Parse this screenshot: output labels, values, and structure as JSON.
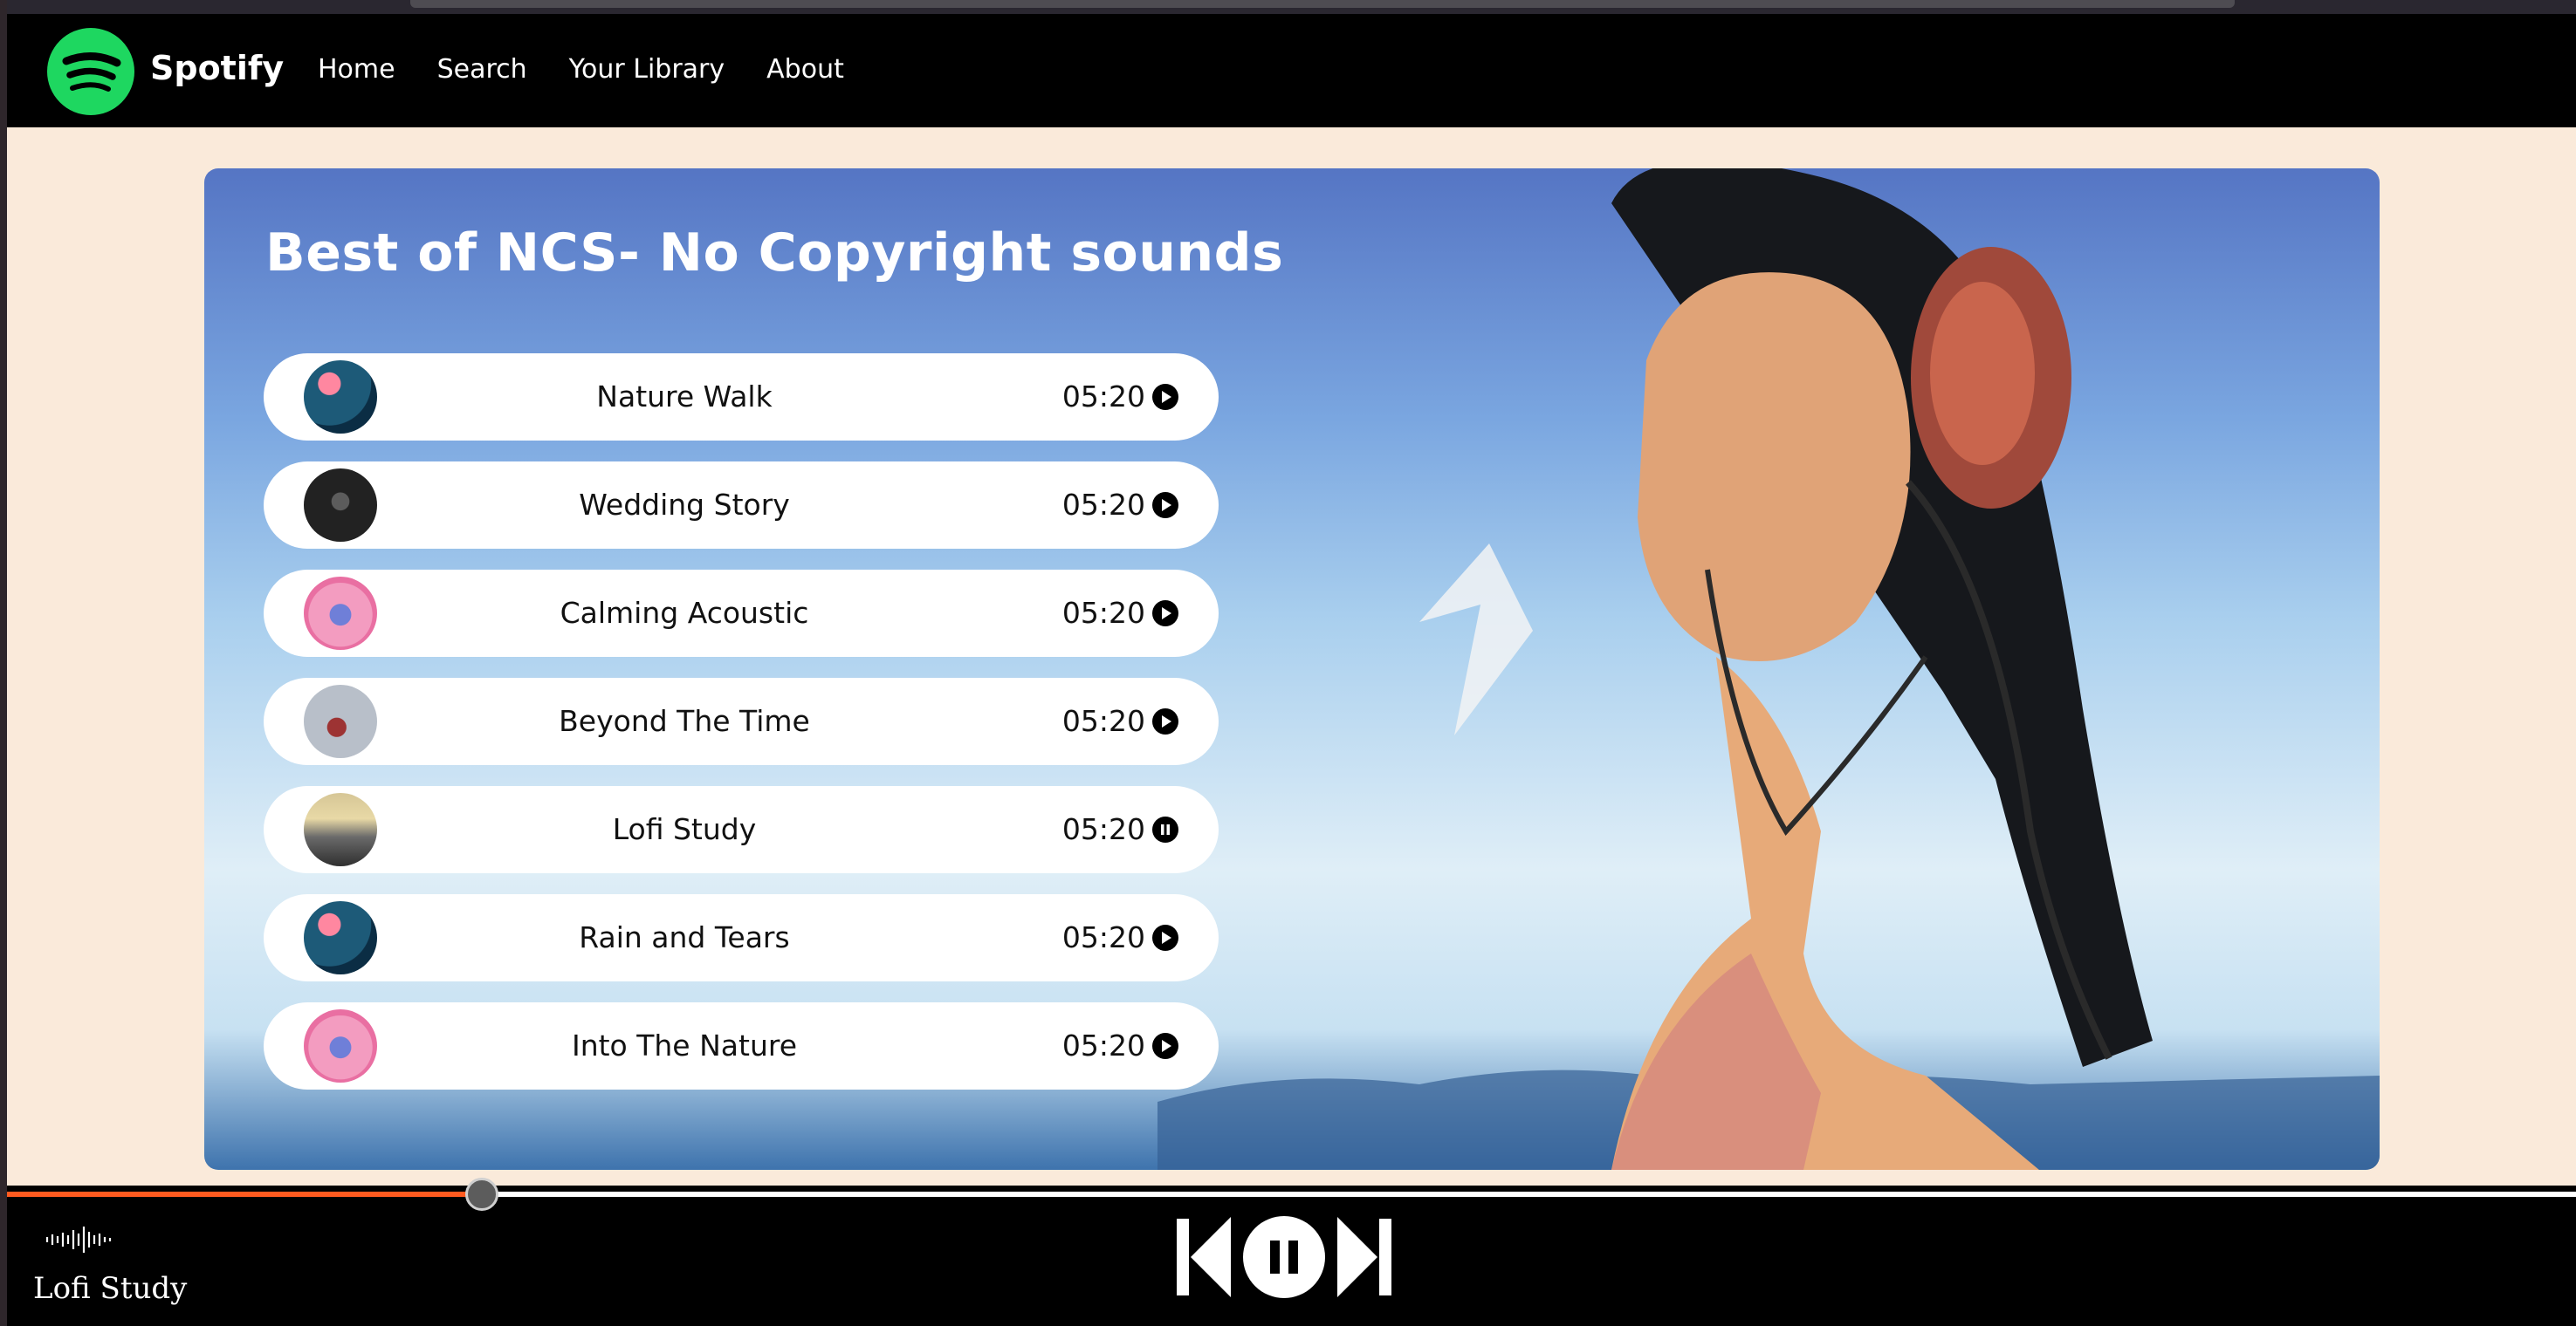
{
  "nav": {
    "brand": "Spotify",
    "links": [
      "Home",
      "Search",
      "Your Library",
      "About"
    ]
  },
  "playlist": {
    "title": "Best of NCS- No Copyright sounds",
    "songs": [
      {
        "name": "Nature Walk",
        "duration": "05:20",
        "state": "play"
      },
      {
        "name": "Wedding Story",
        "duration": "05:20",
        "state": "play"
      },
      {
        "name": "Calming Acoustic",
        "duration": "05:20",
        "state": "play"
      },
      {
        "name": "Beyond The Time",
        "duration": "05:20",
        "state": "play"
      },
      {
        "name": "Lofi Study",
        "duration": "05:20",
        "state": "pause"
      },
      {
        "name": "Rain and Tears",
        "duration": "05:20",
        "state": "play"
      },
      {
        "name": "Into The Nature",
        "duration": "05:20",
        "state": "play"
      }
    ]
  },
  "player": {
    "now_playing": "Lofi Study",
    "progress_percent": 18.6
  },
  "colors": {
    "brand_green": "#1ed760",
    "progress_orange": "#ff5a1f",
    "page_background": "#faeada"
  },
  "icons": [
    "spotify-logo-icon",
    "play-circle-icon",
    "pause-circle-icon",
    "waveform-icon",
    "previous-track-icon",
    "pause-icon",
    "next-track-icon"
  ]
}
